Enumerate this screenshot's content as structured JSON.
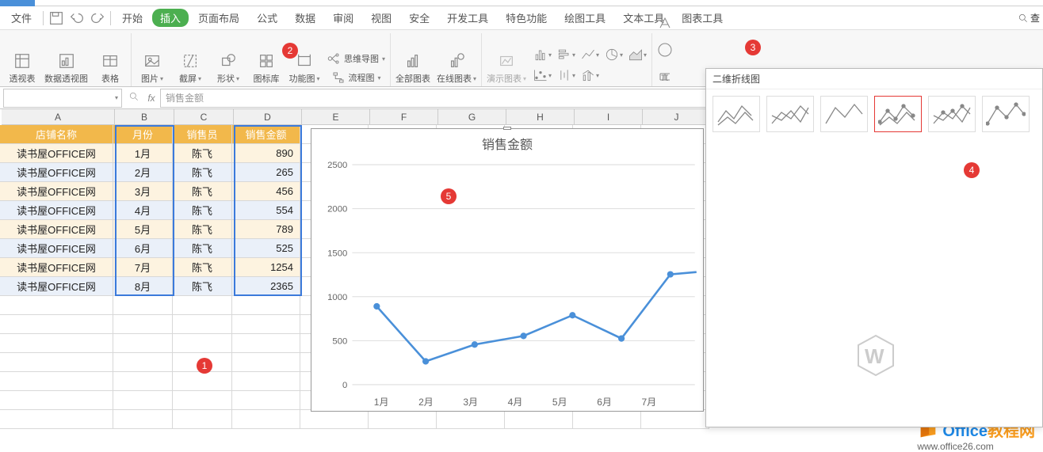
{
  "tabs": {
    "file": "文件",
    "home": "开始",
    "insert": "插入",
    "pagelayout": "页面布局",
    "formulas": "公式",
    "data": "数据",
    "review": "审阅",
    "view": "视图",
    "security": "安全",
    "developer": "开发工具",
    "special": "特色功能",
    "drawtools": "绘图工具",
    "texttools": "文本工具",
    "charttools": "图表工具",
    "search": "查"
  },
  "ribbon": {
    "pivotreport": "透视表",
    "pivotchart": "数据透视图",
    "table": "表格",
    "picture": "图片",
    "screenshot": "截屏",
    "shapes": "形状",
    "iconlib": "图标库",
    "funcchart": "功能图",
    "mindmap": "思维导图",
    "flowchart": "流程图",
    "allcharts": "全部图表",
    "onlinecharts": "在线图表",
    "demochart": "演示图表"
  },
  "formula_bar": {
    "name": "",
    "fx": "fx",
    "content": "销售金额"
  },
  "columns": [
    "A",
    "B",
    "C",
    "D",
    "E",
    "F",
    "G",
    "H",
    "I",
    "J"
  ],
  "table_headers": {
    "A": "店铺名称",
    "B": "月份",
    "C": "销售员",
    "D": "销售金额"
  },
  "table_rows": [
    {
      "A": "读书屋OFFICE网",
      "B": "1月",
      "C": "陈飞",
      "D": "890"
    },
    {
      "A": "读书屋OFFICE网",
      "B": "2月",
      "C": "陈飞",
      "D": "265"
    },
    {
      "A": "读书屋OFFICE网",
      "B": "3月",
      "C": "陈飞",
      "D": "456"
    },
    {
      "A": "读书屋OFFICE网",
      "B": "4月",
      "C": "陈飞",
      "D": "554"
    },
    {
      "A": "读书屋OFFICE网",
      "B": "5月",
      "C": "陈飞",
      "D": "789"
    },
    {
      "A": "读书屋OFFICE网",
      "B": "6月",
      "C": "陈飞",
      "D": "525"
    },
    {
      "A": "读书屋OFFICE网",
      "B": "7月",
      "C": "陈飞",
      "D": "1254"
    },
    {
      "A": "读书屋OFFICE网",
      "B": "8月",
      "C": "陈飞",
      "D": "2365"
    }
  ],
  "chart_panel": {
    "title": "二维折线图"
  },
  "chart_data": {
    "type": "line",
    "title": "销售金额",
    "categories": [
      "1月",
      "2月",
      "3月",
      "4月",
      "5月",
      "6月",
      "7月"
    ],
    "values": [
      890,
      265,
      456,
      554,
      789,
      525,
      1254
    ],
    "ylabel": "",
    "xlabel": "",
    "yticks": [
      0,
      500,
      1000,
      1500,
      2000,
      2500
    ],
    "ylim": [
      0,
      2500
    ]
  },
  "badges": {
    "1": "1",
    "2": "2",
    "3": "3",
    "4": "4",
    "5": "5"
  },
  "watermark": {
    "line1a": "Office",
    "line1b": "教程网",
    "line2": "www.office26.com"
  }
}
